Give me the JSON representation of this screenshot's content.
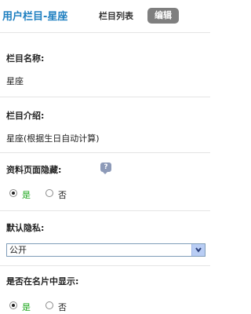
{
  "header": {
    "title": "用户栏目-星座",
    "tab_list": "栏目列表",
    "tab_edit": "编辑"
  },
  "form": {
    "name_label": "栏目名称:",
    "name_value": "星座",
    "desc_label": "栏目介绍:",
    "desc_value": "星座(根据生日自动计算)",
    "hide_label": "资料页面隐藏:",
    "hide_help_icon": "help-bubble-icon",
    "hide_options": [
      {
        "label": "是",
        "checked": true
      },
      {
        "label": "否",
        "checked": false
      }
    ],
    "privacy_label": "默认隐私:",
    "privacy_value": "公开",
    "card_label": "是否在名片中显示:",
    "card_options": [
      {
        "label": "是",
        "checked": true
      },
      {
        "label": "否",
        "checked": false
      }
    ]
  },
  "colors": {
    "title": "#1e7fc0",
    "edit_tab_bg": "#7f7f7f",
    "yes_text": "#1aa51a",
    "select_button": "#b9cdf4"
  }
}
